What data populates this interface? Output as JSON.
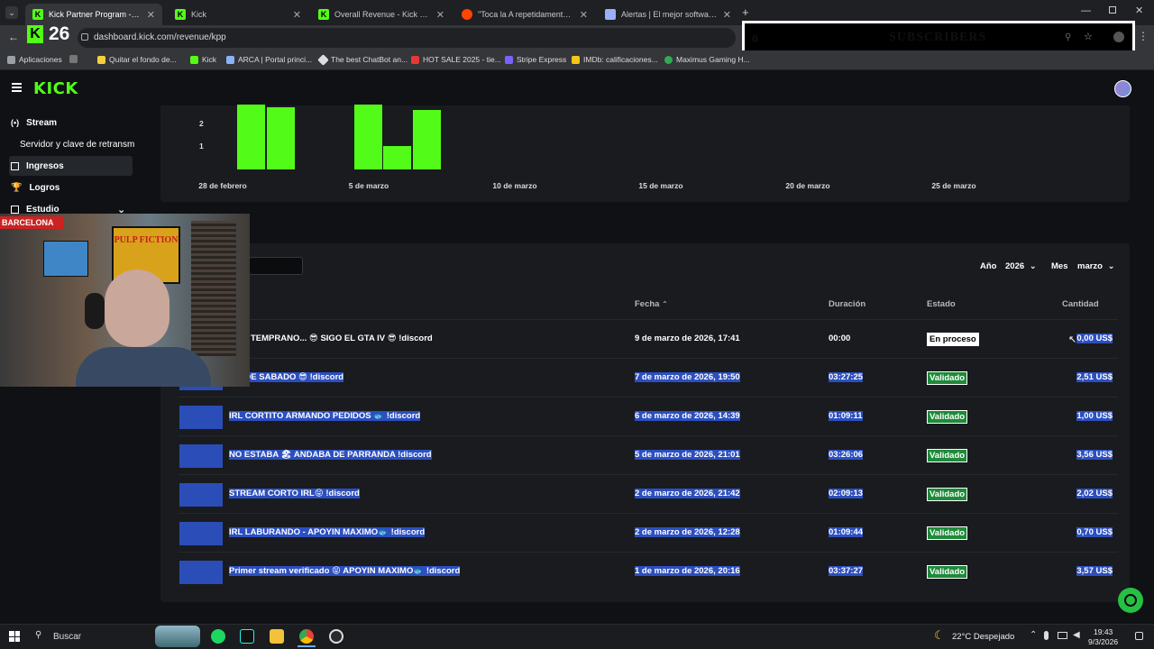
{
  "browser": {
    "tabs": [
      {
        "title": "Kick Partner Program - Kick Da",
        "active": true
      },
      {
        "title": "Kick",
        "active": false
      },
      {
        "title": "Overall Revenue - Kick Dashbo",
        "active": false
      },
      {
        "title": "\"Toca la A repetidamente para",
        "active": false
      },
      {
        "title": "Alertas | El mejor software para",
        "active": false
      }
    ],
    "url": "dashboard.kick.com/revenue/kpp",
    "overlay_counter": "26",
    "bookmarks": [
      "Aplicaciones",
      "Quitar el fondo de...",
      "Kick",
      "ARCA | Portal princi...",
      "The best ChatBot an...",
      "HOT SALE 2025 - tie...",
      "Stripe Express",
      "IMDb: calificaciones...",
      "Maximus Gaming H..."
    ],
    "subscribers_overlay": {
      "count": "0",
      "label": "SUBSCRIBERS"
    }
  },
  "sidebar": {
    "items": [
      {
        "label": "Stream"
      },
      {
        "label": "Servidor y clave de retransm"
      },
      {
        "label": "Ingresos"
      },
      {
        "label": "Logros"
      },
      {
        "label": "Estudio"
      }
    ],
    "active": "Ingresos"
  },
  "chart_data": {
    "type": "bar",
    "ytick_labels": [
      "2",
      "1"
    ],
    "xtick_labels": [
      "28 de febrero",
      "5 de marzo",
      "10 de marzo",
      "15 de marzo",
      "20 de marzo",
      "25 de marzo"
    ],
    "x": [
      "2026-03-01",
      "2026-03-02",
      "2026-03-05",
      "2026-03-06",
      "2026-03-07"
    ],
    "values": [
      2.7,
      2.6,
      2.7,
      1.0,
      2.5
    ],
    "color": "#53fc18"
  },
  "filters": {
    "year_label": "Año",
    "year_value": "2026",
    "month_label": "Mes",
    "month_value": "marzo"
  },
  "table": {
    "headers": {
      "date": "Fecha",
      "duration": "Duración",
      "status": "Estado",
      "amount": "Cantidad"
    },
    "rows": [
      {
        "title": "TEMPRANO... 😎 SIGO EL GTA IV 😎 !discord",
        "date": "9 de marzo de 2026, 17:41",
        "duration": "00:00",
        "status": "En proceso",
        "amount": "0,00 US$"
      },
      {
        "title": "AM DE SABADO 😎 !discord",
        "date": "7 de marzo de 2026, 19:50",
        "duration": "03:27:25",
        "status": "Validado",
        "amount": "2,51 US$"
      },
      {
        "title": "IRL CORTITO ARMANDO PEDIDOS 🐟 !discord",
        "date": "6 de marzo de 2026, 14:39",
        "duration": "01:09:11",
        "status": "Validado",
        "amount": "1,00 US$"
      },
      {
        "title": "NO ESTABA 🏖 ANDABA DE PARRANDA !discord",
        "date": "5 de marzo de 2026, 21:01",
        "duration": "03:26:06",
        "status": "Validado",
        "amount": "3,56 US$"
      },
      {
        "title": "STREAM CORTO IRL😝 !discord",
        "date": "2 de marzo de 2026, 21:42",
        "duration": "02:09:13",
        "status": "Validado",
        "amount": "2,02 US$"
      },
      {
        "title": "IRL LABURANDO - APOYIN MAXIMO🐟 !discord",
        "date": "2 de marzo de 2026, 12:28",
        "duration": "01:09:44",
        "status": "Validado",
        "amount": "0,70 US$"
      },
      {
        "title": "Primer stream verificado 😝 APOYIN MAXIMO🐟 !discord",
        "date": "1 de marzo de 2026, 20:16",
        "duration": "03:37:27",
        "status": "Validado",
        "amount": "3,57 US$"
      }
    ]
  },
  "webcam": {
    "banner_left": "BARCELONA",
    "poster_text": "PULP FICTION"
  },
  "taskbar": {
    "search": "Buscar",
    "weather": "22°C Despejado",
    "time": "19:43",
    "date": "9/3/2026"
  }
}
